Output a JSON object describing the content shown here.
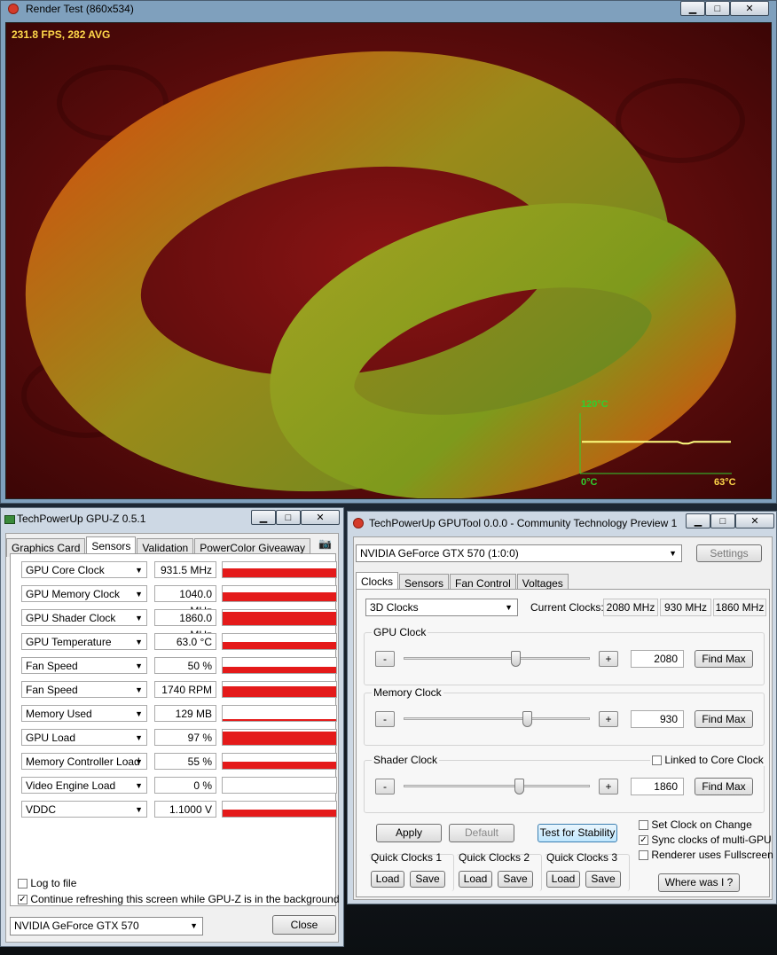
{
  "render_window": {
    "title": "Render Test (860x534)",
    "fps": "231.8 FPS, 282 AVG",
    "temp_max": "120°C",
    "temp_min": "0°C",
    "temp_current": "63°C",
    "temp_level_pct": 52.5
  },
  "gpuz": {
    "title": "TechPowerUp GPU-Z 0.5.1",
    "tabs": [
      "Graphics Card",
      "Sensors",
      "Validation",
      "PowerColor Giveaway"
    ],
    "active_tab": "Sensors",
    "sensors": [
      {
        "name": "GPU Core Clock",
        "value": "931.5 MHz",
        "fill_pct": 60
      },
      {
        "name": "GPU Memory Clock",
        "value": "1040.0 MHz",
        "fill_pct": 60
      },
      {
        "name": "GPU Shader Clock",
        "value": "1860.0 MHz",
        "fill_pct": 90
      },
      {
        "name": "GPU Temperature",
        "value": "63.0 °C",
        "fill_pct": 45
      },
      {
        "name": "Fan Speed",
        "value": "50 %",
        "fill_pct": 40
      },
      {
        "name": "Fan Speed",
        "value": "1740 RPM",
        "fill_pct": 70
      },
      {
        "name": "Memory Used",
        "value": "129 MB",
        "fill_pct": 10
      },
      {
        "name": "GPU Load",
        "value": "97 %",
        "fill_pct": 90
      },
      {
        "name": "Memory Controller Load",
        "value": "55 %",
        "fill_pct": 50
      },
      {
        "name": "Video Engine Load",
        "value": "0 %",
        "fill_pct": 0
      },
      {
        "name": "VDDC",
        "value": "1.1000 V",
        "fill_pct": 45
      }
    ],
    "log_to_file": "Log to file",
    "continue_refresh": "Continue refreshing this screen while GPU-Z is in the background",
    "continue_refresh_checked": true,
    "gpu_select": "NVIDIA GeForce GTX 570",
    "close_label": "Close"
  },
  "gputool": {
    "title": "TechPowerUp GPUTool 0.0.0 - Community Technology Preview 1",
    "gpu_select": "NVIDIA GeForce GTX 570 (1:0:0)",
    "settings_label": "Settings",
    "tabs": [
      "Clocks",
      "Sensors",
      "Fan Control",
      "Voltages"
    ],
    "active_tab": "Clocks",
    "clock_profile": "3D Clocks",
    "current_clocks_label": "Current Clocks:",
    "current_clocks": [
      "2080 MHz",
      "930 MHz",
      "1860 MHz"
    ],
    "gpu_clock": {
      "label": "GPU Clock",
      "value": "2080",
      "position": 0.6
    },
    "memory_clock": {
      "label": "Memory Clock",
      "value": "930",
      "position": 0.66
    },
    "shader_clock": {
      "label": "Shader Clock",
      "value": "1860",
      "position": 0.62
    },
    "linked_core": "Linked to Core Clock",
    "minus": "-",
    "plus": "+",
    "find_max": "Find Max",
    "apply": "Apply",
    "default": "Default",
    "test_stability": "Test for Stability",
    "set_clock_on_change": "Set Clock on Change",
    "sync_clocks": "Sync clocks of multi-GPU",
    "renderer_fullscreen": "Renderer uses Fullscreen",
    "quick_clocks": [
      "Quick Clocks 1",
      "Quick Clocks 2",
      "Quick Clocks 3"
    ],
    "load": "Load",
    "save": "Save",
    "where_was_i": "Where was I ?"
  },
  "colors": {
    "graph_red": "#e41a1a",
    "temp_green": "#2fd02f",
    "fps_yellow": "#ffd84a"
  }
}
